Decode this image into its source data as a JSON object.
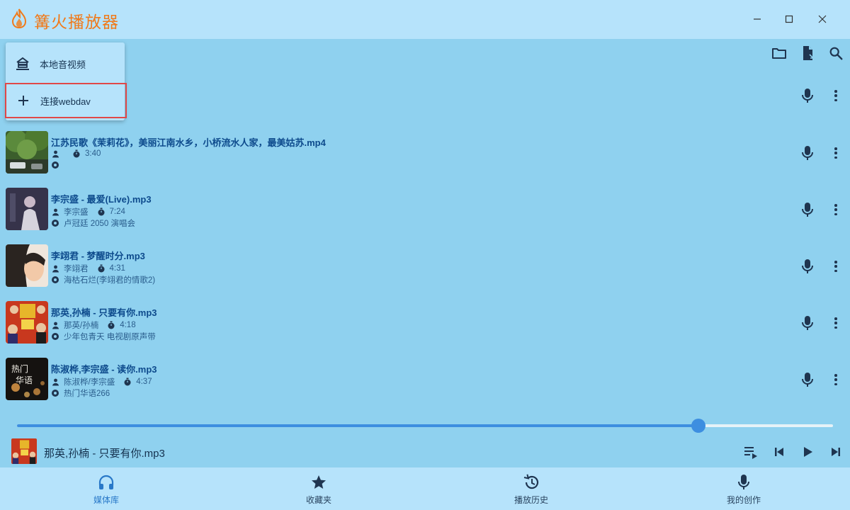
{
  "app": {
    "title": "篝火播放器",
    "accent": "#f07a1a"
  },
  "window_controls": {
    "minimize": "—",
    "maximize": "☐",
    "close": "✕"
  },
  "toolbar": {
    "icons": [
      "folder-icon",
      "file-open-icon",
      "search-icon"
    ]
  },
  "menu": {
    "items": [
      {
        "label": "本地音视频",
        "icon": "building-icon"
      },
      {
        "label": "连接webdav",
        "icon": "plus-icon"
      }
    ]
  },
  "tracks": [
    {
      "title": "江苏民歌《茉莉花》，美丽江南水乡，小桥流水人家，最美姑苏.mp4",
      "artist": "",
      "duration": "3:40",
      "album": ""
    },
    {
      "title": "李宗盛 - 最爱(Live).mp3",
      "artist": "李宗盛",
      "duration": "7:24",
      "album": "卢冠廷 2050 演唱会"
    },
    {
      "title": "李翊君 - 梦醒时分.mp3",
      "artist": "李翊君",
      "duration": "4:31",
      "album": "海枯石烂(李翊君的情歌2)"
    },
    {
      "title": "那英,孙楠 - 只要有你.mp3",
      "artist": "那英/孙楠",
      "duration": "4:18",
      "album": "少年包青天 电视剧原声带"
    },
    {
      "title": "陈淑桦,李宗盛 - 读你.mp3",
      "artist": "陈淑桦/李宗盛",
      "duration": "4:37",
      "album": "热门华语266"
    }
  ],
  "thumb_text": {
    "hot_chinese_line1": "热门",
    "hot_chinese_line2": "华语"
  },
  "player": {
    "now_playing": "那英,孙楠 - 只要有你.mp3",
    "progress_fraction": 0.835,
    "controls": [
      "playlist-icon",
      "previous-icon",
      "play-icon",
      "next-icon"
    ]
  },
  "bottom_nav": {
    "items": [
      {
        "label": "媒体库",
        "icon": "headphones-icon",
        "active": true
      },
      {
        "label": "收藏夹",
        "icon": "star-icon",
        "active": false
      },
      {
        "label": "播放历史",
        "icon": "history-icon",
        "active": false
      },
      {
        "label": "我的创作",
        "icon": "mic-icon",
        "active": false
      }
    ]
  },
  "colors": {
    "background": "#8fd1ef",
    "bar": "#b6e3fb",
    "primary": "#3d8ee0",
    "highlight": "#e04848"
  }
}
